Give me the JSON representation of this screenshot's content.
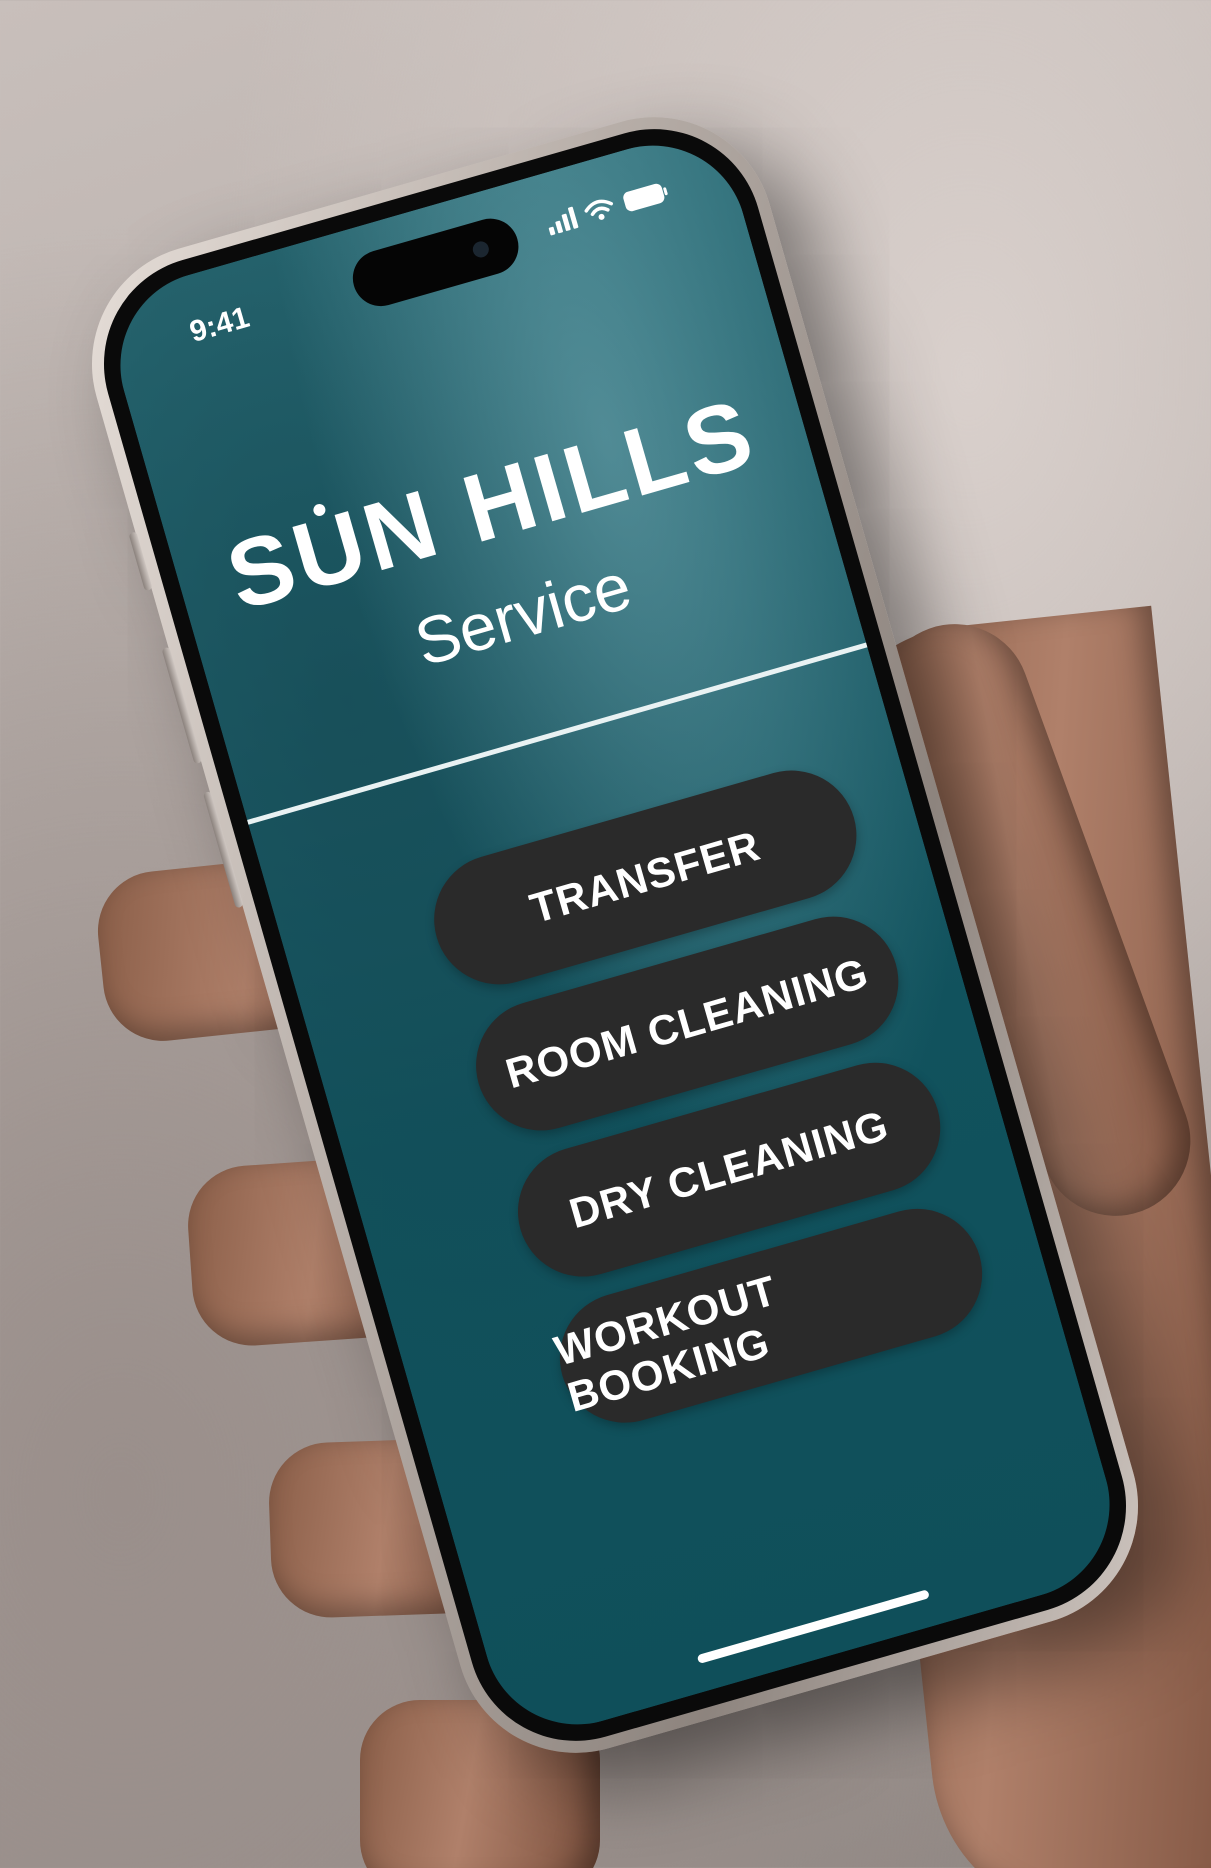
{
  "status_bar": {
    "time": "9:41",
    "icons": [
      "cellular-signal-icon",
      "wifi-icon",
      "battery-icon"
    ]
  },
  "header": {
    "brand": "SUN HILLS",
    "brand_parts": {
      "before_u": "S",
      "u": "U",
      "after_u": "N HILLS"
    },
    "subtitle": "Service"
  },
  "services": [
    {
      "label": "TRANSFER"
    },
    {
      "label": "ROOM CLEANING"
    },
    {
      "label": "DRY CLEANING"
    },
    {
      "label": "WORKOUT BOOKING"
    }
  ],
  "colors": {
    "screen_background": "#1c5b66",
    "button_background": "#2a2a2a",
    "text": "#ffffff"
  }
}
